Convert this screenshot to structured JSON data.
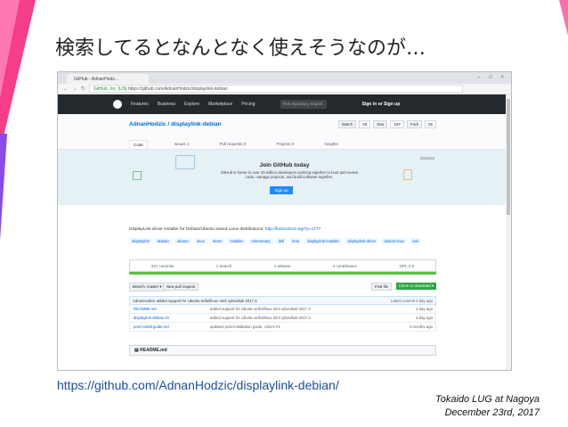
{
  "slide": {
    "title": "検索してるとなんとなく使えそうなのが…",
    "url_caption": "https://github.com/AdnanHodzic/displaylink-debian/",
    "event": "Tokaido LUG at Nagoya",
    "date": "December 23rd, 2017",
    "accent_colors": [
      "#f53d8a",
      "#8a4be8"
    ]
  },
  "browser": {
    "tab_title": "GitHub - AdnanHodz...",
    "window_controls": "– □ ×",
    "url": "https://github.com/AdnanHodzic/displaylink-debian",
    "url_prefix": "GitHub, Inc. [US]"
  },
  "github": {
    "nav": [
      "Features",
      "Business",
      "Explore",
      "Marketplace",
      "Pricing"
    ],
    "search_placeholder": "This repository   Search",
    "signin": "Sign in or Sign up"
  },
  "repo": {
    "title": "AdnanHodzic / displaylink-debian",
    "buttons": [
      {
        "label": "Watch",
        "count": "25"
      },
      {
        "label": "Star",
        "count": "197"
      },
      {
        "label": "Fork",
        "count": "25"
      }
    ],
    "tabs": [
      "Code",
      "Issues 1",
      "Pull requests 0",
      "Projects 0",
      "Insights"
    ],
    "banner": {
      "label": "Dismiss",
      "title": "Join GitHub today",
      "text": "GitHub is home to over 20 million developers working together to host and review code, manage projects, and build software together.",
      "button": "Sign up"
    },
    "description": "DisplayLink driver installer for Debian/Ubuntu based Linux distributions:",
    "description_link": "http://foolcontrol.org/?p=1777",
    "topics": [
      "displaylink",
      "debian",
      "ubuntu",
      "linux",
      "driver",
      "installer",
      "elementary",
      "dell",
      "kms",
      "displaylink-installer",
      "displaylink-driver",
      "debian-linux",
      "kali"
    ],
    "summary": [
      "321 commits",
      "1 branch",
      "1 release",
      "4 contributors",
      "GPL-3.0"
    ],
    "branch": "Branch: master ▾",
    "new_pr": "New pull request",
    "find_file": "Find file",
    "clone": "Clone or download ▾",
    "latest_commit": "AdnanHodzic added support for Ubuntu artful/linux mint sylvia/kali 2017.3",
    "latest_commit_right": "Latest commit 1 day ago",
    "files": [
      {
        "name": "README.md",
        "message": "added support for Ubuntu artful/linux mint sylvia/kali 2017.3",
        "age": "a day ago"
      },
      {
        "name": "displaylink-debian.sh",
        "message": "added support for Ubuntu artful/linux mint sylvia/kali 2017.3",
        "age": "a day ago"
      },
      {
        "name": "post-install-guide.md",
        "message": "updated post-installation guide, closes #1",
        "age": "3 months ago"
      }
    ],
    "readme": "README.md"
  }
}
